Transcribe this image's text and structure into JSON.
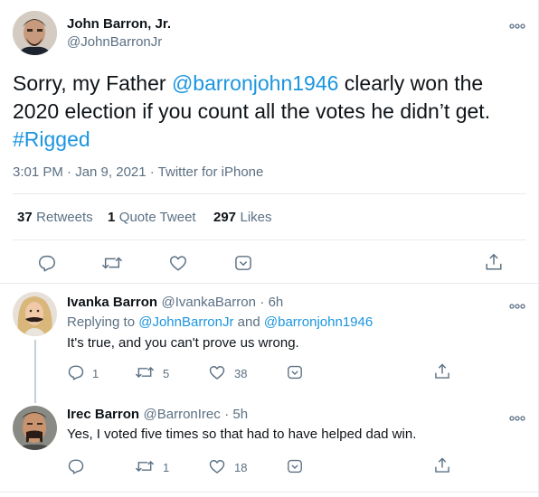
{
  "main_tweet": {
    "author_name": "John Barron, Jr.",
    "author_handle": "@JohnBarronJr",
    "text_before": "Sorry, my Father ",
    "mention": "@barronjohn1946",
    "text_after": " clearly won the 2020 election if you count all the votes he didn’t get. ",
    "hashtag": "#Rigged",
    "meta": "3:01 PM · Jan 9, 2021 · Twitter for iPhone",
    "stats": {
      "retweets_count": "37",
      "retweets_label": "Retweets",
      "quotes_count": "1",
      "quotes_label": "Quote Tweet",
      "likes_count": "297",
      "likes_label": "Likes"
    },
    "icons": [
      "reply-icon",
      "retweet-icon",
      "like-icon",
      "more-icon",
      "share-icon"
    ]
  },
  "replies": [
    {
      "author_name": "Ivanka Barron",
      "author_handle": "@IvankaBarron",
      "time": "· 6h",
      "replying_prefix": "Replying to ",
      "replying_to_1": "@JohnBarronJr",
      "replying_and": " and ",
      "replying_to_2": "@barronjohn1946",
      "text": "It's true, and you can't prove us wrong.",
      "reply_count": "1",
      "retweet_count": "5",
      "like_count": "38"
    },
    {
      "author_name": "Irec Barron",
      "author_handle": "@BarronIrec",
      "time": "· 5h",
      "text": "Yes, I voted five times so that had to have helped dad win.",
      "reply_count": "",
      "retweet_count": "1",
      "like_count": "18"
    }
  ],
  "colors": {
    "link": "#1b95e0",
    "secondary_text": "#5b7083",
    "divider": "#e6ecf0",
    "icon": "#5b7083"
  }
}
